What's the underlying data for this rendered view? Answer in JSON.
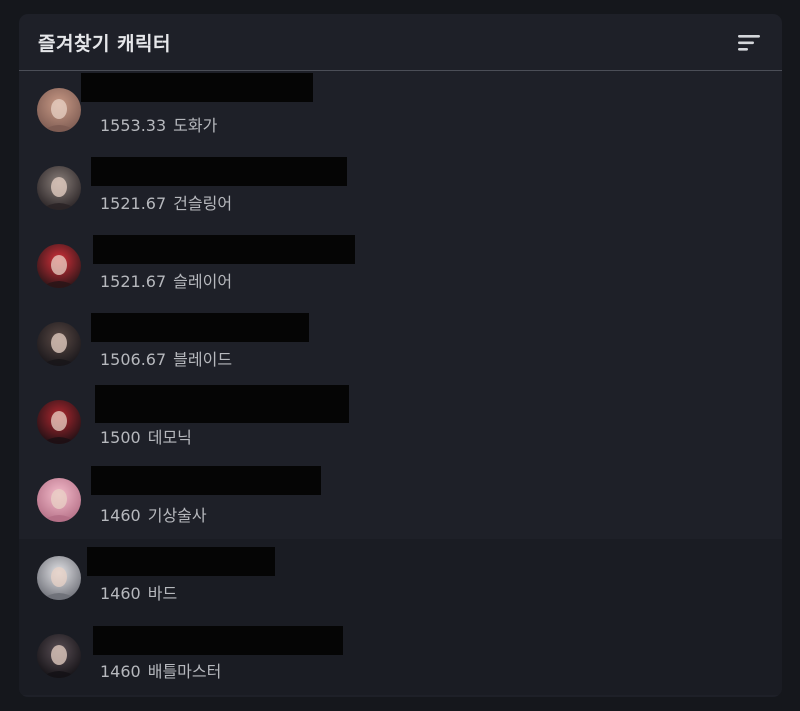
{
  "header": {
    "title": "즐겨찾기 캐릭터",
    "sort_icon": "sort-lines-icon"
  },
  "characters": [
    {
      "level": "1553.33",
      "class": "도화가",
      "avatar_colors": [
        "#c99a86",
        "#7d5b52"
      ]
    },
    {
      "level": "1521.67",
      "class": "건슬링어",
      "avatar_colors": [
        "#8a7f7a",
        "#2a2426"
      ]
    },
    {
      "level": "1521.67",
      "class": "슬레이어",
      "avatar_colors": [
        "#d7303a",
        "#2a1517"
      ]
    },
    {
      "level": "1506.67",
      "class": "블레이드",
      "avatar_colors": [
        "#5b4a45",
        "#18161a"
      ]
    },
    {
      "level": "1500",
      "class": "데모닉",
      "avatar_colors": [
        "#b32830",
        "#1d1014"
      ]
    },
    {
      "level": "1460",
      "class": "기상술사",
      "avatar_colors": [
        "#f4bccb",
        "#b46f86"
      ]
    },
    {
      "level": "1460",
      "class": "바드",
      "avatar_colors": [
        "#e3e3e6",
        "#6e7078"
      ]
    },
    {
      "level": "1460",
      "class": "배틀마스터",
      "avatar_colors": [
        "#5a4f55",
        "#141216"
      ]
    }
  ],
  "colors": {
    "page_background": "#15171c",
    "panel_background": "#1e2028",
    "alt_row_background": "#1a1c23",
    "title_text": "#e6e7ea",
    "secondary_text": "#b6b8bd",
    "divider": "#4b4e57",
    "redaction": "#050505"
  }
}
